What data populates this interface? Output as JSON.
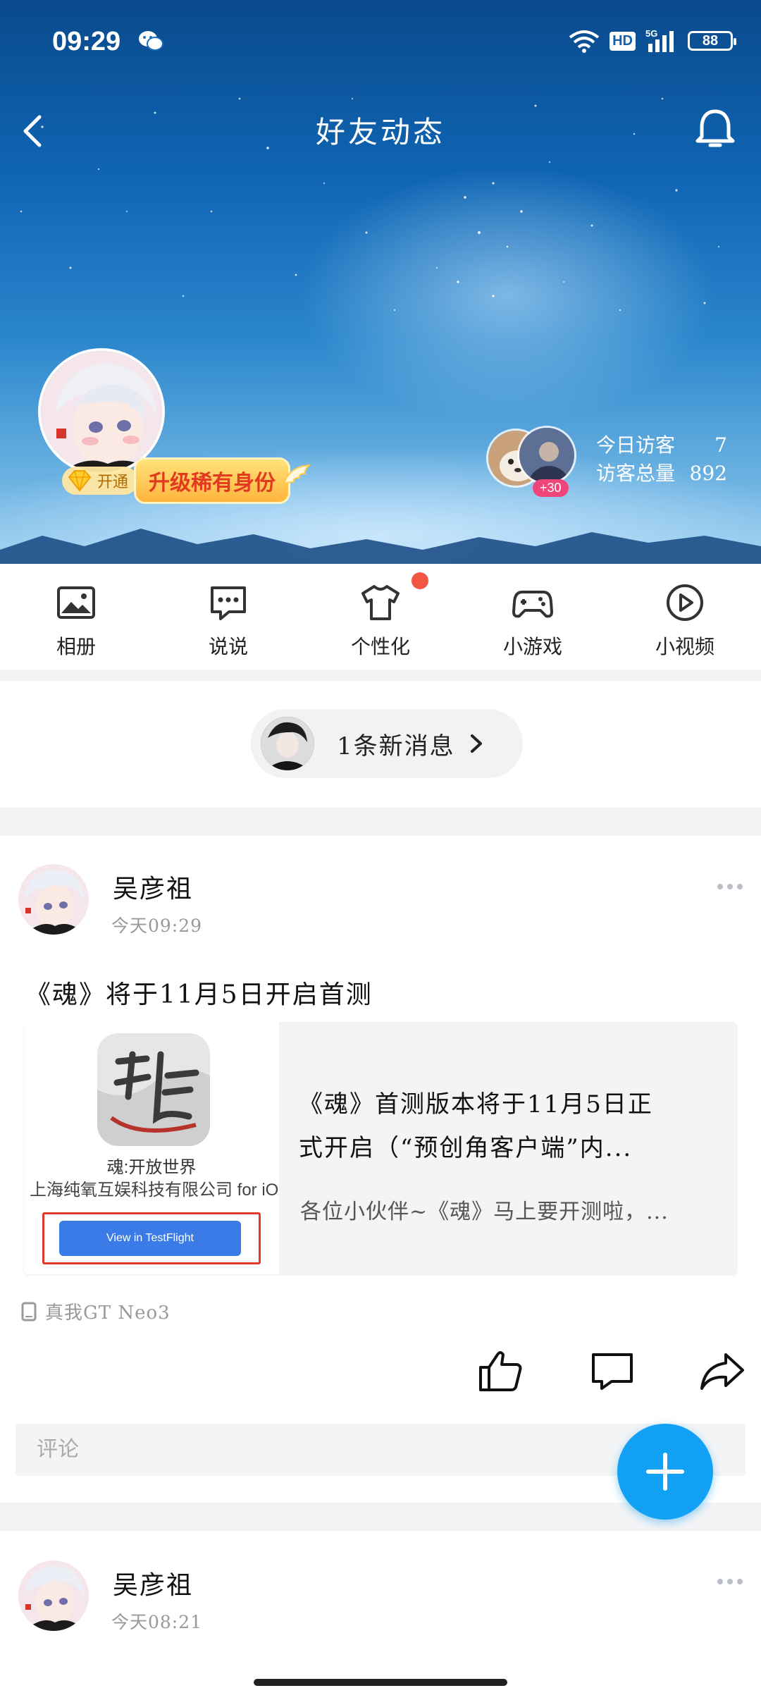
{
  "status_bar": {
    "time": "09:29",
    "network": "5G",
    "hd": "HD",
    "battery": "88"
  },
  "header": {
    "title": "好友动态",
    "vip_open_label": "开通",
    "upgrade_label": "升级稀有身份",
    "visitors_plus": "+30",
    "today_visitors_label": "今日访客",
    "today_visitors": "7",
    "total_visitors_label": "访客总量",
    "total_visitors": "892"
  },
  "quick_menu": [
    {
      "label": "相册",
      "icon": "photo-album-icon"
    },
    {
      "label": "说说",
      "icon": "chat-bubble-icon"
    },
    {
      "label": "个性化",
      "icon": "tshirt-icon"
    },
    {
      "label": "小游戏",
      "icon": "gamepad-icon"
    },
    {
      "label": "小视频",
      "icon": "play-circle-icon"
    }
  ],
  "new_message": {
    "text": "1条新消息"
  },
  "posts": [
    {
      "author": "吴彦祖",
      "time": "今天09:29",
      "text": "《魂》将于11月5日开启首测",
      "link_card": {
        "app_name": "魂:开放世界",
        "developer": "上海纯氧互娱科技有限公司 for iOS",
        "testflight_button": "View in TestFlight",
        "title_line1": "《魂》首测版本将于11月5日正",
        "title_line2": "式开启（“预创角客户端”内...",
        "description": "各位小伙伴~《魂》马上要开测啦，..."
      },
      "device": "真我GT Neo3",
      "comment_placeholder": "评论"
    },
    {
      "author": "吴彦祖",
      "time": "今天08:21"
    }
  ],
  "colors": {
    "accent": "#12a1f4",
    "badge_red": "#f25643",
    "testflight_blue": "#3a7be8"
  }
}
